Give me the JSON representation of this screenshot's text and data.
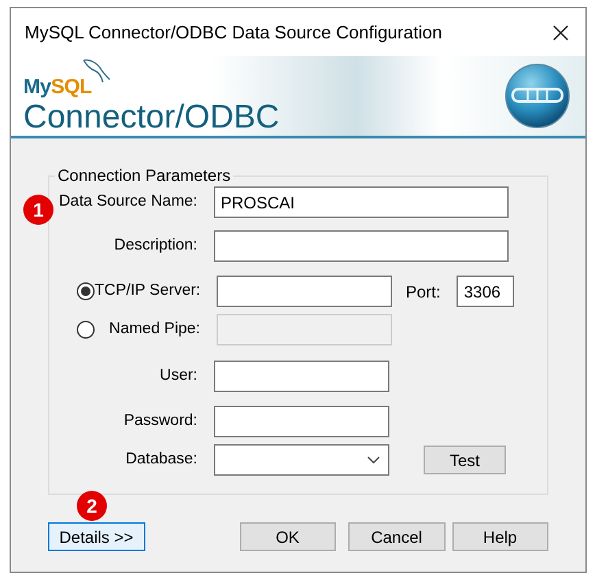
{
  "window": {
    "title": "MySQL Connector/ODBC Data Source Configuration"
  },
  "banner": {
    "logo_prefix": "My",
    "logo_suffix": "SQL",
    "product": "Connector/ODBC"
  },
  "group": {
    "title": "Connection Parameters"
  },
  "fields": [
    {
      "kind": "text",
      "label": "Data Source Name:",
      "value": "PROSCAI",
      "wide": true
    },
    {
      "kind": "text",
      "label": "Description:",
      "wide": true
    },
    {
      "kind": "radio",
      "label": "TCP/IP Server:",
      "selected": true,
      "disabled": false,
      "port_label": "Port:",
      "port_value": "3306"
    },
    {
      "kind": "radio",
      "label": "Named Pipe:",
      "selected": false,
      "disabled": true
    },
    {
      "kind": "text",
      "label": "User:",
      "wide": false
    },
    {
      "kind": "text",
      "label": "Password:",
      "wide": false
    },
    {
      "kind": "combo",
      "label": "Database:",
      "button": "Test"
    }
  ],
  "buttons": [
    {
      "label": "Details >>",
      "focused": true
    },
    {
      "label": "OK",
      "focused": false
    },
    {
      "label": "Cancel",
      "focused": false
    },
    {
      "label": "Help",
      "focused": false
    }
  ],
  "markers": [
    {
      "label": "1"
    },
    {
      "label": "2"
    }
  ]
}
